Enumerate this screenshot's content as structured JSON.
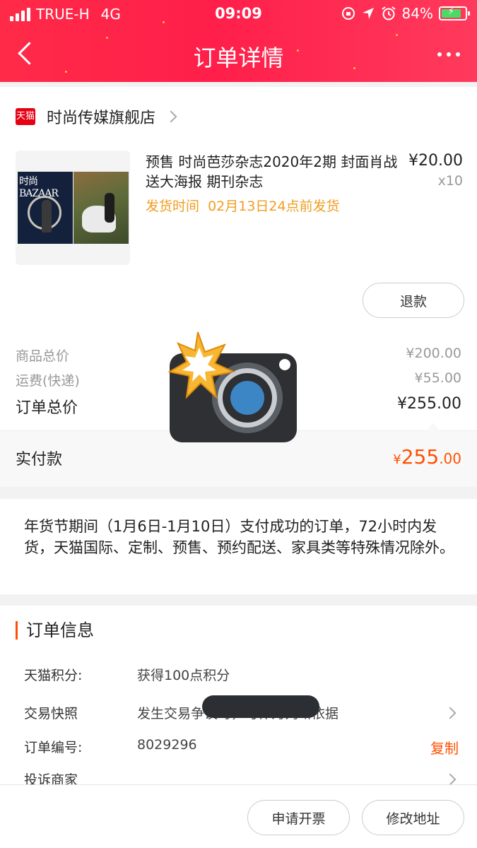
{
  "status_bar": {
    "carrier": "TRUE-H",
    "network": "4G",
    "time": "09:09",
    "battery": "84%",
    "battery_level": 0.84
  },
  "nav": {
    "title": "订单详情"
  },
  "shop": {
    "logo_text": "天猫",
    "name": "时尚传媒旗舰店"
  },
  "product": {
    "cover_brand": "时尚BAZAAR",
    "title": "预售 时尚芭莎杂志2020年2期 封面肖战  送大海报 期刊杂志",
    "ship_label": "发货时间",
    "ship_time": "02月13日24点前发货",
    "price": "¥20.00",
    "qty": "x10",
    "refund_label": "退款"
  },
  "summary": {
    "goods_total_label": "商品总价",
    "goods_total": "¥200.00",
    "shipping_label": "运费(快递)",
    "shipping": "¥55.00",
    "order_total_label": "订单总价",
    "order_total": "¥255.00",
    "paid_label": "实付款",
    "paid_currency": "¥",
    "paid_integer": "255",
    "paid_decimal": ".00"
  },
  "notice": {
    "text": "年货节期间（1月6日-1月10日）支付成功的订单，72小时内发货，天猫国际、定制、预售、预约配送、家具类等特殊情况除外。"
  },
  "order_info": {
    "title": "订单信息",
    "points_label": "天猫积分:",
    "points_value": "获得100点积分",
    "snapshot_label": "交易快照",
    "snapshot_value": "发生交易争议时，可作为判断依据",
    "order_no_label": "订单编号:",
    "order_no_value": "8029296",
    "copy_label": "复制",
    "complain_label": "投诉商家"
  },
  "footer": {
    "invoice_label": "申请开票",
    "address_label": "修改地址"
  },
  "colors": {
    "header_red": "#ff2a48",
    "accent_orange": "#ff5000",
    "ship_orange": "#f29c1f",
    "tmall_red": "#e60012"
  }
}
